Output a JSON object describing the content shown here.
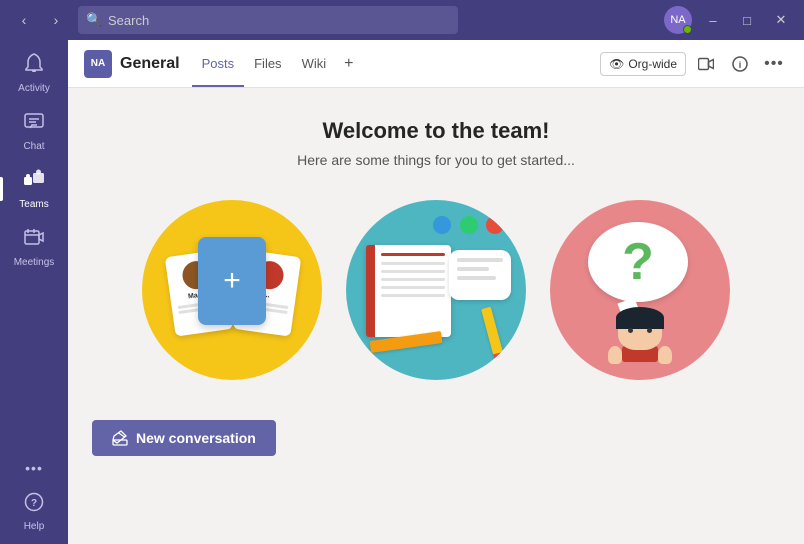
{
  "titlebar": {
    "search_placeholder": "Search",
    "minimize_label": "–",
    "maximize_label": "□",
    "close_label": "✕",
    "avatar_initials": "NA"
  },
  "sidebar": {
    "items": [
      {
        "id": "activity",
        "label": "Activity",
        "icon": "🔔"
      },
      {
        "id": "chat",
        "label": "Chat",
        "icon": "💬"
      },
      {
        "id": "teams",
        "label": "Teams",
        "icon": "⊞",
        "active": true
      },
      {
        "id": "meetings",
        "label": "Meetings",
        "icon": "📅"
      },
      {
        "id": "more",
        "label": "···",
        "icon": "···"
      }
    ],
    "help_label": "Help"
  },
  "channel": {
    "avatar_text": "NA",
    "name": "General",
    "tabs": [
      {
        "id": "posts",
        "label": "Posts",
        "active": true
      },
      {
        "id": "files",
        "label": "Files",
        "active": false
      },
      {
        "id": "wiki",
        "label": "Wiki",
        "active": false
      }
    ],
    "add_tab_label": "+",
    "org_wide_label": "Org-wide"
  },
  "welcome": {
    "title": "Welcome to the team!",
    "subtitle": "Here are some things for you to get started..."
  },
  "toolbar": {
    "new_conversation_label": "New conversation"
  }
}
